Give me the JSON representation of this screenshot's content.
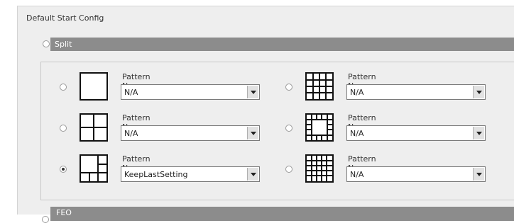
{
  "group": {
    "title": "Default Start Config"
  },
  "split": {
    "label": "Split",
    "selected": false
  },
  "bottom_option": {
    "label": "FEO",
    "selected": false
  },
  "patterns": [
    {
      "label": "Pattern Name",
      "value": "N/A",
      "selected": false,
      "icon": "single-view-icon"
    },
    {
      "label": "Pattern Name",
      "value": "N/A",
      "selected": false,
      "icon": "grid-4x4-view-icon"
    },
    {
      "label": "Pattern Name",
      "value": "N/A",
      "selected": false,
      "icon": "quad-view-icon"
    },
    {
      "label": "Pattern Name",
      "value": "N/A",
      "selected": false,
      "icon": "ring-layout-view-icon"
    },
    {
      "label": "Pattern Name",
      "value": "KeepLastSetting",
      "selected": true,
      "icon": "one-plus-five-view-icon"
    },
    {
      "label": "Pattern Name",
      "value": "N/A",
      "selected": false,
      "icon": "grid-5x5-view-icon"
    }
  ]
}
